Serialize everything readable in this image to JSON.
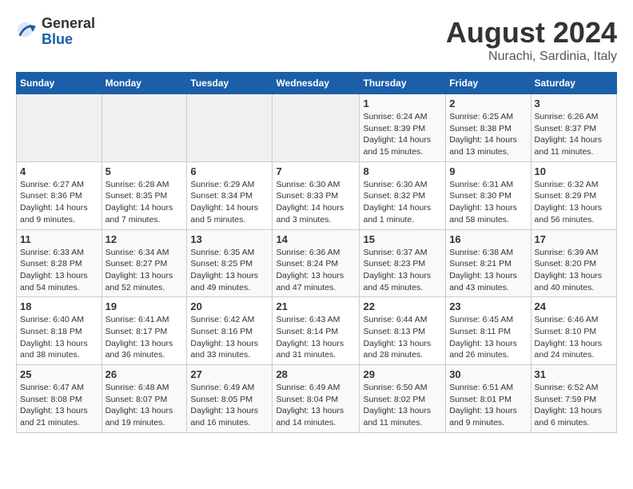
{
  "logo": {
    "general": "General",
    "blue": "Blue"
  },
  "title": {
    "month_year": "August 2024",
    "location": "Nurachi, Sardinia, Italy"
  },
  "calendar": {
    "headers": [
      "Sunday",
      "Monday",
      "Tuesday",
      "Wednesday",
      "Thursday",
      "Friday",
      "Saturday"
    ],
    "weeks": [
      [
        {
          "day": "",
          "info": ""
        },
        {
          "day": "",
          "info": ""
        },
        {
          "day": "",
          "info": ""
        },
        {
          "day": "",
          "info": ""
        },
        {
          "day": "1",
          "info": "Sunrise: 6:24 AM\nSunset: 8:39 PM\nDaylight: 14 hours\nand 15 minutes."
        },
        {
          "day": "2",
          "info": "Sunrise: 6:25 AM\nSunset: 8:38 PM\nDaylight: 14 hours\nand 13 minutes."
        },
        {
          "day": "3",
          "info": "Sunrise: 6:26 AM\nSunset: 8:37 PM\nDaylight: 14 hours\nand 11 minutes."
        }
      ],
      [
        {
          "day": "4",
          "info": "Sunrise: 6:27 AM\nSunset: 8:36 PM\nDaylight: 14 hours\nand 9 minutes."
        },
        {
          "day": "5",
          "info": "Sunrise: 6:28 AM\nSunset: 8:35 PM\nDaylight: 14 hours\nand 7 minutes."
        },
        {
          "day": "6",
          "info": "Sunrise: 6:29 AM\nSunset: 8:34 PM\nDaylight: 14 hours\nand 5 minutes."
        },
        {
          "day": "7",
          "info": "Sunrise: 6:30 AM\nSunset: 8:33 PM\nDaylight: 14 hours\nand 3 minutes."
        },
        {
          "day": "8",
          "info": "Sunrise: 6:30 AM\nSunset: 8:32 PM\nDaylight: 14 hours\nand 1 minute."
        },
        {
          "day": "9",
          "info": "Sunrise: 6:31 AM\nSunset: 8:30 PM\nDaylight: 13 hours\nand 58 minutes."
        },
        {
          "day": "10",
          "info": "Sunrise: 6:32 AM\nSunset: 8:29 PM\nDaylight: 13 hours\nand 56 minutes."
        }
      ],
      [
        {
          "day": "11",
          "info": "Sunrise: 6:33 AM\nSunset: 8:28 PM\nDaylight: 13 hours\nand 54 minutes."
        },
        {
          "day": "12",
          "info": "Sunrise: 6:34 AM\nSunset: 8:27 PM\nDaylight: 13 hours\nand 52 minutes."
        },
        {
          "day": "13",
          "info": "Sunrise: 6:35 AM\nSunset: 8:25 PM\nDaylight: 13 hours\nand 49 minutes."
        },
        {
          "day": "14",
          "info": "Sunrise: 6:36 AM\nSunset: 8:24 PM\nDaylight: 13 hours\nand 47 minutes."
        },
        {
          "day": "15",
          "info": "Sunrise: 6:37 AM\nSunset: 8:23 PM\nDaylight: 13 hours\nand 45 minutes."
        },
        {
          "day": "16",
          "info": "Sunrise: 6:38 AM\nSunset: 8:21 PM\nDaylight: 13 hours\nand 43 minutes."
        },
        {
          "day": "17",
          "info": "Sunrise: 6:39 AM\nSunset: 8:20 PM\nDaylight: 13 hours\nand 40 minutes."
        }
      ],
      [
        {
          "day": "18",
          "info": "Sunrise: 6:40 AM\nSunset: 8:18 PM\nDaylight: 13 hours\nand 38 minutes."
        },
        {
          "day": "19",
          "info": "Sunrise: 6:41 AM\nSunset: 8:17 PM\nDaylight: 13 hours\nand 36 minutes."
        },
        {
          "day": "20",
          "info": "Sunrise: 6:42 AM\nSunset: 8:16 PM\nDaylight: 13 hours\nand 33 minutes."
        },
        {
          "day": "21",
          "info": "Sunrise: 6:43 AM\nSunset: 8:14 PM\nDaylight: 13 hours\nand 31 minutes."
        },
        {
          "day": "22",
          "info": "Sunrise: 6:44 AM\nSunset: 8:13 PM\nDaylight: 13 hours\nand 28 minutes."
        },
        {
          "day": "23",
          "info": "Sunrise: 6:45 AM\nSunset: 8:11 PM\nDaylight: 13 hours\nand 26 minutes."
        },
        {
          "day": "24",
          "info": "Sunrise: 6:46 AM\nSunset: 8:10 PM\nDaylight: 13 hours\nand 24 minutes."
        }
      ],
      [
        {
          "day": "25",
          "info": "Sunrise: 6:47 AM\nSunset: 8:08 PM\nDaylight: 13 hours\nand 21 minutes."
        },
        {
          "day": "26",
          "info": "Sunrise: 6:48 AM\nSunset: 8:07 PM\nDaylight: 13 hours\nand 19 minutes."
        },
        {
          "day": "27",
          "info": "Sunrise: 6:49 AM\nSunset: 8:05 PM\nDaylight: 13 hours\nand 16 minutes."
        },
        {
          "day": "28",
          "info": "Sunrise: 6:49 AM\nSunset: 8:04 PM\nDaylight: 13 hours\nand 14 minutes."
        },
        {
          "day": "29",
          "info": "Sunrise: 6:50 AM\nSunset: 8:02 PM\nDaylight: 13 hours\nand 11 minutes."
        },
        {
          "day": "30",
          "info": "Sunrise: 6:51 AM\nSunset: 8:01 PM\nDaylight: 13 hours\nand 9 minutes."
        },
        {
          "day": "31",
          "info": "Sunrise: 6:52 AM\nSunset: 7:59 PM\nDaylight: 13 hours\nand 6 minutes."
        }
      ]
    ]
  }
}
